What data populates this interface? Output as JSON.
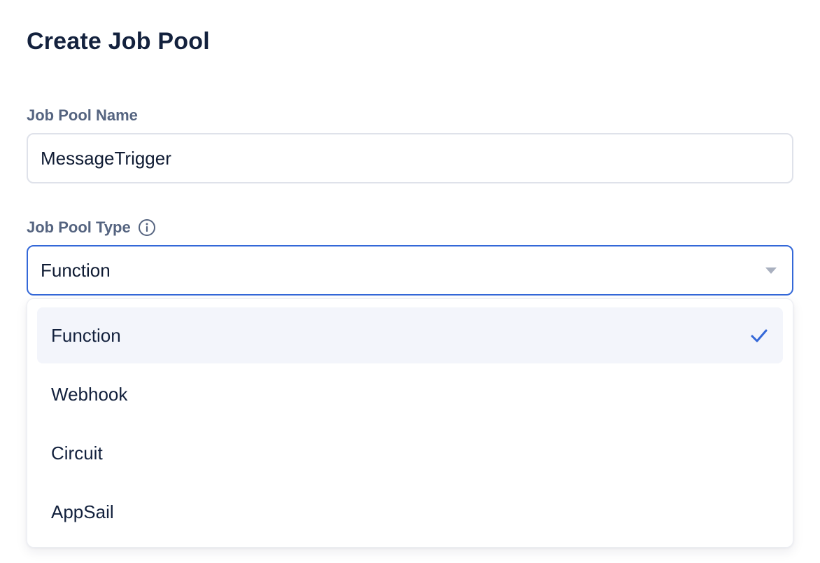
{
  "page": {
    "title": "Create Job Pool"
  },
  "form": {
    "name_field": {
      "label": "Job Pool Name",
      "value": "MessageTrigger"
    },
    "type_field": {
      "label": "Job Pool Type",
      "info_icon": "info-icon",
      "selected_value": "Function",
      "options": [
        {
          "label": "Function",
          "selected": true
        },
        {
          "label": "Webhook",
          "selected": false
        },
        {
          "label": "Circuit",
          "selected": false
        },
        {
          "label": "AppSail",
          "selected": false
        }
      ]
    }
  },
  "colors": {
    "accent": "#3468d8",
    "title_text": "#13213d",
    "label_text": "#556480",
    "input_border": "#dfe2ea",
    "selected_option_bg": "#f3f5fb"
  }
}
